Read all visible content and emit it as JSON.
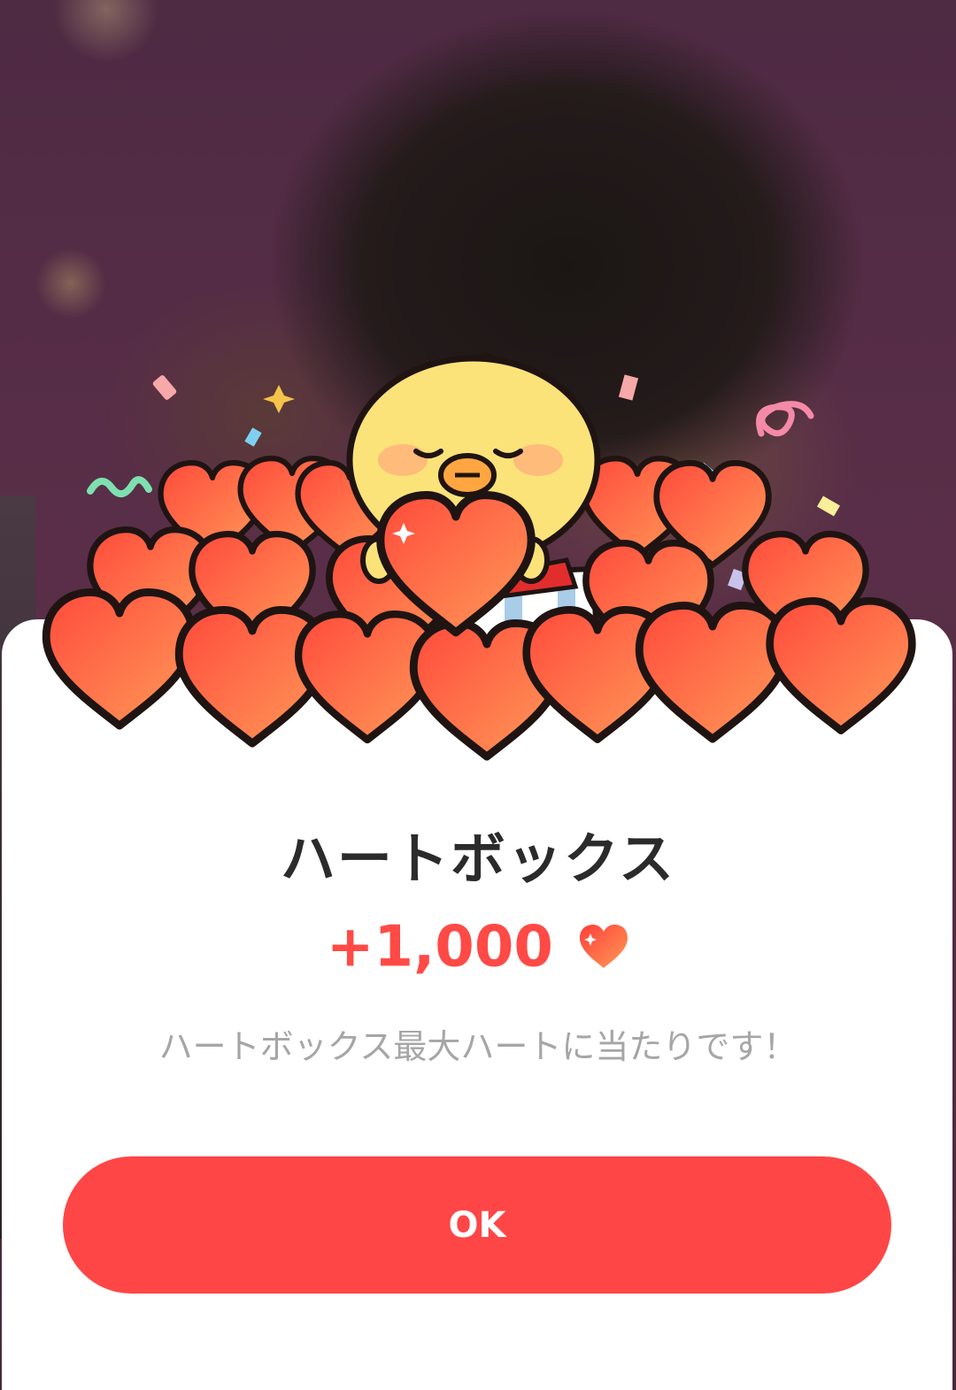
{
  "dialog": {
    "title": "ハートボックス",
    "reward_amount": "+1,000",
    "reward_icon": "heart-icon",
    "message": "ハートボックス最大ハートに当たりです！",
    "ok_label": "OK"
  },
  "colors": {
    "accent": "#ff4646",
    "reward_text": "#ff4a46",
    "title_text": "#2b2b2b",
    "message_text": "#a6a6a6"
  }
}
